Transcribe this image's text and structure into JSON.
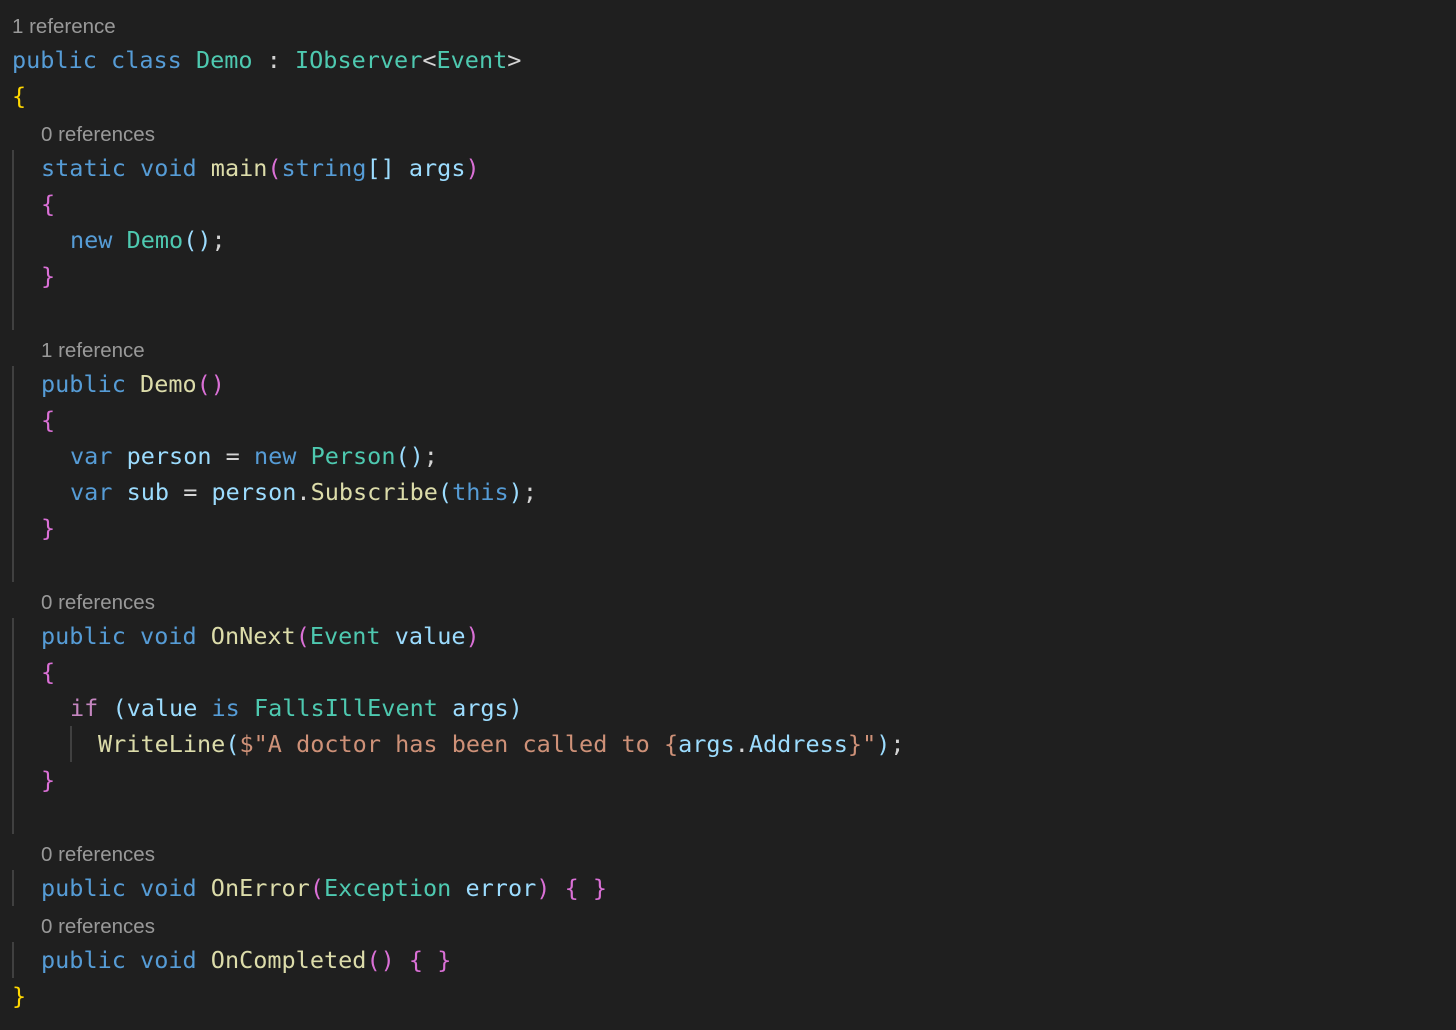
{
  "codelens": {
    "class": "1 reference",
    "main": "0 references",
    "ctor": "1 reference",
    "onnext": "0 references",
    "onerror": "0 references",
    "oncompleted": "0 references"
  },
  "code": {
    "kw_public": "public",
    "kw_class": "class",
    "class_name": "Demo",
    "colon": ":",
    "iface": "IObserver",
    "lt": "<",
    "event_type": "Event",
    "gt": ">",
    "open_brace": "{",
    "close_brace": "}",
    "kw_static": "static",
    "kw_void": "void",
    "main_name": "main",
    "lparen": "(",
    "rparen": ")",
    "kw_string": "string",
    "brackets": "[]",
    "args": "args",
    "kw_new": "new",
    "call_tail": ";",
    "empty_parens_open": "(",
    "empty_parens_close": ")",
    "kw_var": "var",
    "person": "person",
    "equals": "=",
    "person_type": "Person",
    "sub": "sub",
    "dot": ".",
    "subscribe": "Subscribe",
    "kw_this": "this",
    "onnext_name": "OnNext",
    "value": "value",
    "kw_if": "if",
    "kw_is": "is",
    "falls_ill": "FallsIllEvent",
    "writeline": "WriteLine",
    "str_prefix": "$\"A doctor has been called to ",
    "interp_open": "{",
    "address": "Address",
    "interp_close": "}",
    "str_end": "\"",
    "onerror_name": "OnError",
    "exception": "Exception",
    "error": "error",
    "empty_body": "{ }",
    "oncompleted_name": "OnCompleted"
  }
}
